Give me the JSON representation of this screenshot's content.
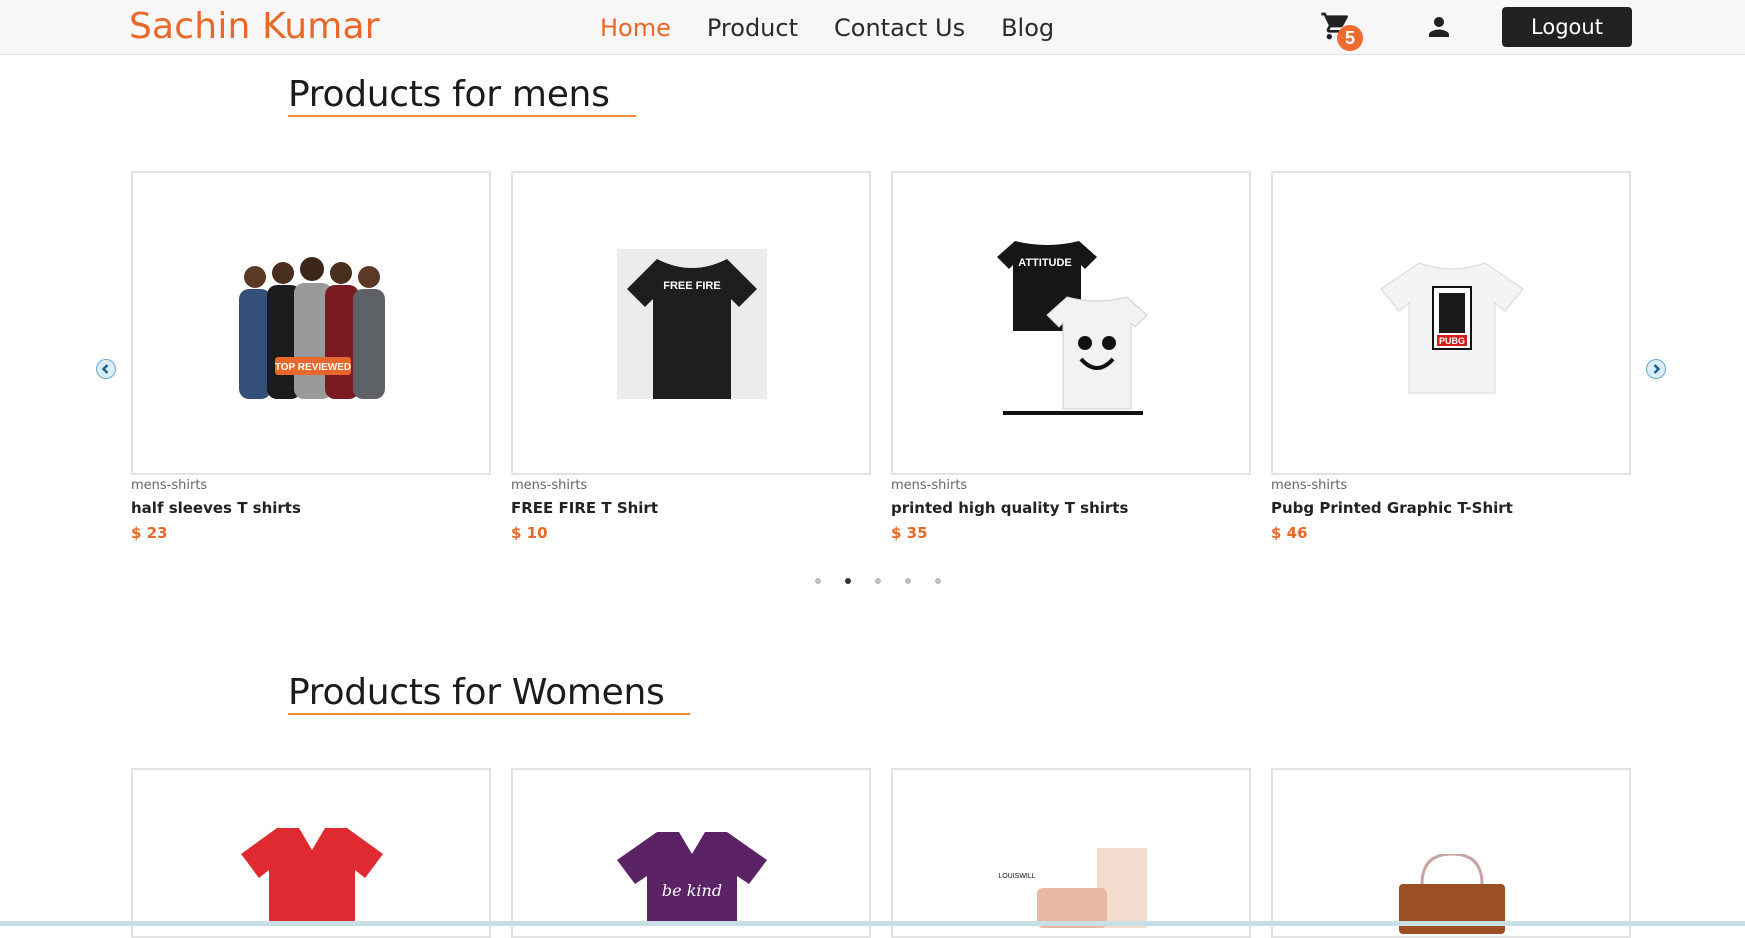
{
  "brand": "Sachin Kumar",
  "nav": [
    "Home",
    "Product",
    "Contact Us",
    "Blog"
  ],
  "cart_count": "5",
  "logout_label": "Logout",
  "sections": {
    "mens": {
      "title": "Products for mens",
      "products": [
        {
          "category": "mens-shirts",
          "title": "half sleeves T shirts",
          "price": "$ 23",
          "badge": "TOP REVIEWED"
        },
        {
          "category": "mens-shirts",
          "title": "FREE FIRE T Shirt",
          "price": "$ 10",
          "print": "FREE FIRE"
        },
        {
          "category": "mens-shirts",
          "title": "printed high quality T shirts",
          "price": "$ 35",
          "print": "ATTITUDE"
        },
        {
          "category": "mens-shirts",
          "title": "Pubg Printed Graphic T-Shirt",
          "price": "$ 46",
          "print": "PUBG"
        }
      ],
      "dots": 5,
      "active_dot": 1
    },
    "womens": {
      "title": "Products for Womens",
      "product_prints": [
        "",
        "be kind",
        "LOUISWILL",
        ""
      ]
    }
  },
  "colors": {
    "accent": "#e8682a",
    "dark": "#222222"
  }
}
